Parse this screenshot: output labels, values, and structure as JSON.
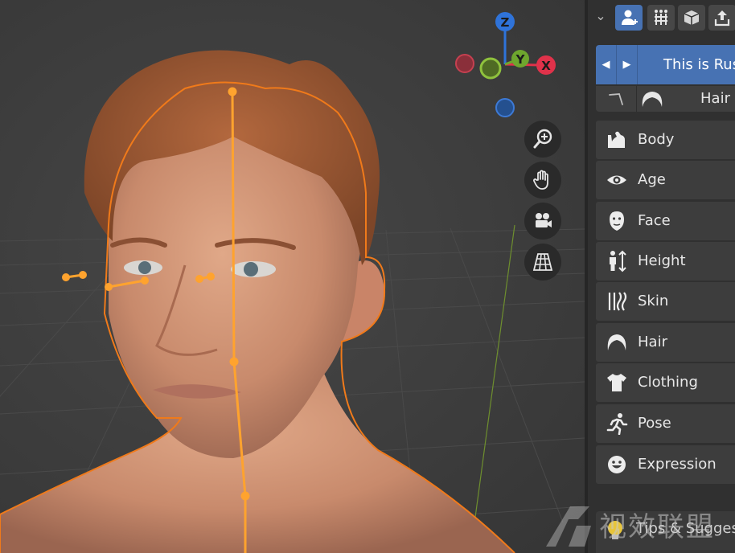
{
  "viewport": {
    "gizmo": {
      "z_label": "Z",
      "y_label": "Y",
      "x_label": "X",
      "z_color": "#2f73d9",
      "y_color": "#6ea62e",
      "x_color": "#e0324a"
    },
    "nav_buttons": [
      "zoom-icon",
      "hand-pan-icon",
      "camera-icon",
      "perspective-grid-icon"
    ],
    "selection_color": "#f07a1a"
  },
  "sidebar": {
    "tabs": [
      {
        "name": "human-add-icon",
        "active": true
      },
      {
        "name": "rig-bones-icon",
        "active": false
      },
      {
        "name": "cube-asset-icon",
        "active": false
      },
      {
        "name": "export-icon",
        "active": false
      }
    ],
    "preset": {
      "name": "This is Rus"
    },
    "hair_row": {
      "label": "Hair"
    },
    "categories": [
      {
        "icon": "body-icon",
        "label": "Body"
      },
      {
        "icon": "eye-icon",
        "label": "Age"
      },
      {
        "icon": "face-icon",
        "label": "Face"
      },
      {
        "icon": "height-icon",
        "label": "Height"
      },
      {
        "icon": "skin-icon",
        "label": "Skin"
      },
      {
        "icon": "hair-icon",
        "label": "Hair"
      },
      {
        "icon": "shirt-icon",
        "label": "Clothing"
      },
      {
        "icon": "running-icon",
        "label": "Pose"
      },
      {
        "icon": "smiley-icon",
        "label": "Expression"
      }
    ],
    "tips": {
      "label": "Tips & Sugges"
    }
  },
  "watermark": {
    "text": "视效联盟"
  }
}
